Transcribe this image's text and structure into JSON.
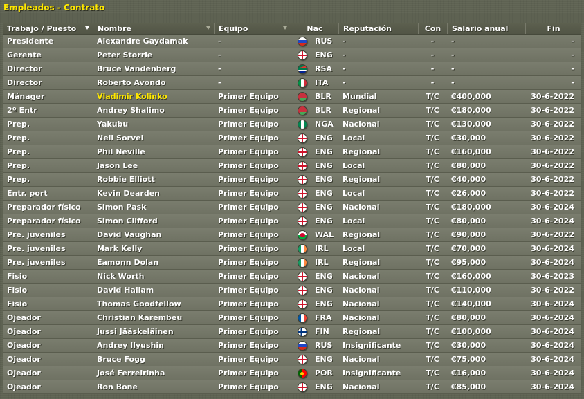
{
  "title": "Empleados - Contrato",
  "columns": {
    "job": "Trabajo / Puesto",
    "name": "Nombre",
    "team": "Equipo",
    "nat": "Nac",
    "rep": "Reputación",
    "con": "Con",
    "salary": "Salario anual",
    "end": "Fin"
  },
  "rows": [
    {
      "job": "Presidente",
      "name": "Alexandre Gaydamak",
      "team": "-",
      "nat": "RUS",
      "rep": "-",
      "con": "-",
      "salary": "-",
      "end": "-"
    },
    {
      "job": "Gerente",
      "name": "Peter Storrie",
      "team": "-",
      "nat": "ENG",
      "rep": "-",
      "con": "-",
      "salary": "-",
      "end": "-"
    },
    {
      "job": "Director",
      "name": "Bruce Vandenberg",
      "team": "-",
      "nat": "RSA",
      "rep": "-",
      "con": "-",
      "salary": "-",
      "end": "-"
    },
    {
      "job": "Director",
      "name": "Roberto Avondo",
      "team": "-",
      "nat": "ITA",
      "rep": "-",
      "con": "-",
      "salary": "-",
      "end": "-"
    },
    {
      "job": "Mánager",
      "name": "Vladimir Kolinko",
      "team": "Primer Equipo",
      "nat": "BLR",
      "rep": "Mundial",
      "con": "T/C",
      "salary": "€400,000",
      "end": "30-6-2022",
      "highlight": true
    },
    {
      "job": "2º Entr",
      "name": "Andrey Shalimo",
      "team": "Primer Equipo",
      "nat": "BLR",
      "rep": "Regional",
      "con": "T/C",
      "salary": "€180,000",
      "end": "30-6-2022"
    },
    {
      "job": "Prep.",
      "name": "Yakubu",
      "team": "Primer Equipo",
      "nat": "NGA",
      "rep": "Nacional",
      "con": "T/C",
      "salary": "€130,000",
      "end": "30-6-2022"
    },
    {
      "job": "Prep.",
      "name": "Neil Sorvel",
      "team": "Primer Equipo",
      "nat": "ENG",
      "rep": "Local",
      "con": "T/C",
      "salary": "€30,000",
      "end": "30-6-2022"
    },
    {
      "job": "Prep.",
      "name": "Phil Neville",
      "team": "Primer Equipo",
      "nat": "ENG",
      "rep": "Regional",
      "con": "T/C",
      "salary": "€160,000",
      "end": "30-6-2022"
    },
    {
      "job": "Prep.",
      "name": "Jason Lee",
      "team": "Primer Equipo",
      "nat": "ENG",
      "rep": "Local",
      "con": "T/C",
      "salary": "€80,000",
      "end": "30-6-2022"
    },
    {
      "job": "Prep.",
      "name": "Robbie Elliott",
      "team": "Primer Equipo",
      "nat": "ENG",
      "rep": "Regional",
      "con": "T/C",
      "salary": "€40,000",
      "end": "30-6-2022"
    },
    {
      "job": "Entr. port",
      "name": "Kevin Dearden",
      "team": "Primer Equipo",
      "nat": "ENG",
      "rep": "Local",
      "con": "T/C",
      "salary": "€26,000",
      "end": "30-6-2022"
    },
    {
      "job": "Preparador físico",
      "name": "Simon Pask",
      "team": "Primer Equipo",
      "nat": "ENG",
      "rep": "Nacional",
      "con": "T/C",
      "salary": "€180,000",
      "end": "30-6-2024"
    },
    {
      "job": "Preparador físico",
      "name": "Simon Clifford",
      "team": "Primer Equipo",
      "nat": "ENG",
      "rep": "Local",
      "con": "T/C",
      "salary": "€80,000",
      "end": "30-6-2024"
    },
    {
      "job": "Pre. juveniles",
      "name": "David Vaughan",
      "team": "Primer Equipo",
      "nat": "WAL",
      "rep": "Regional",
      "con": "T/C",
      "salary": "€90,000",
      "end": "30-6-2022"
    },
    {
      "job": "Pre. juveniles",
      "name": "Mark Kelly",
      "team": "Primer Equipo",
      "nat": "IRL",
      "rep": "Local",
      "con": "T/C",
      "salary": "€70,000",
      "end": "30-6-2024"
    },
    {
      "job": "Pre. juveniles",
      "name": "Eamonn Dolan",
      "team": "Primer Equipo",
      "nat": "IRL",
      "rep": "Regional",
      "con": "T/C",
      "salary": "€95,000",
      "end": "30-6-2024"
    },
    {
      "job": "Fisio",
      "name": "Nick Worth",
      "team": "Primer Equipo",
      "nat": "ENG",
      "rep": "Nacional",
      "con": "T/C",
      "salary": "€160,000",
      "end": "30-6-2023"
    },
    {
      "job": "Fisio",
      "name": "David Hallam",
      "team": "Primer Equipo",
      "nat": "ENG",
      "rep": "Nacional",
      "con": "T/C",
      "salary": "€110,000",
      "end": "30-6-2022"
    },
    {
      "job": "Fisio",
      "name": "Thomas Goodfellow",
      "team": "Primer Equipo",
      "nat": "ENG",
      "rep": "Nacional",
      "con": "T/C",
      "salary": "€140,000",
      "end": "30-6-2024"
    },
    {
      "job": "Ojeador",
      "name": "Christian Karembeu",
      "team": "Primer Equipo",
      "nat": "FRA",
      "rep": "Nacional",
      "con": "T/C",
      "salary": "€80,000",
      "end": "30-6-2024"
    },
    {
      "job": "Ojeador",
      "name": "Jussi Jääskeläinen",
      "team": "Primer Equipo",
      "nat": "FIN",
      "rep": "Regional",
      "con": "T/C",
      "salary": "€100,000",
      "end": "30-6-2024"
    },
    {
      "job": "Ojeador",
      "name": "Andrey Ilyushin",
      "team": "Primer Equipo",
      "nat": "RUS",
      "rep": "Insignificante",
      "con": "T/C",
      "salary": "€30,000",
      "end": "30-6-2024"
    },
    {
      "job": "Ojeador",
      "name": "Bruce Fogg",
      "team": "Primer Equipo",
      "nat": "ENG",
      "rep": "Nacional",
      "con": "T/C",
      "salary": "€75,000",
      "end": "30-6-2024"
    },
    {
      "job": "Ojeador",
      "name": "José Ferreirinha",
      "team": "Primer Equipo",
      "nat": "POR",
      "rep": "Insignificante",
      "con": "T/C",
      "salary": "€16,000",
      "end": "30-6-2024"
    },
    {
      "job": "Ojeador",
      "name": "Ron Bone",
      "team": "Primer Equipo",
      "nat": "ENG",
      "rep": "Nacional",
      "con": "T/C",
      "salary": "€85,000",
      "end": "30-6-2024"
    }
  ],
  "colors": {
    "title": "#ffe800",
    "highlight_name": "#ffe800",
    "row_bg": "#767969",
    "header_bg": "#56594a",
    "page_bg": "#5e6252"
  }
}
